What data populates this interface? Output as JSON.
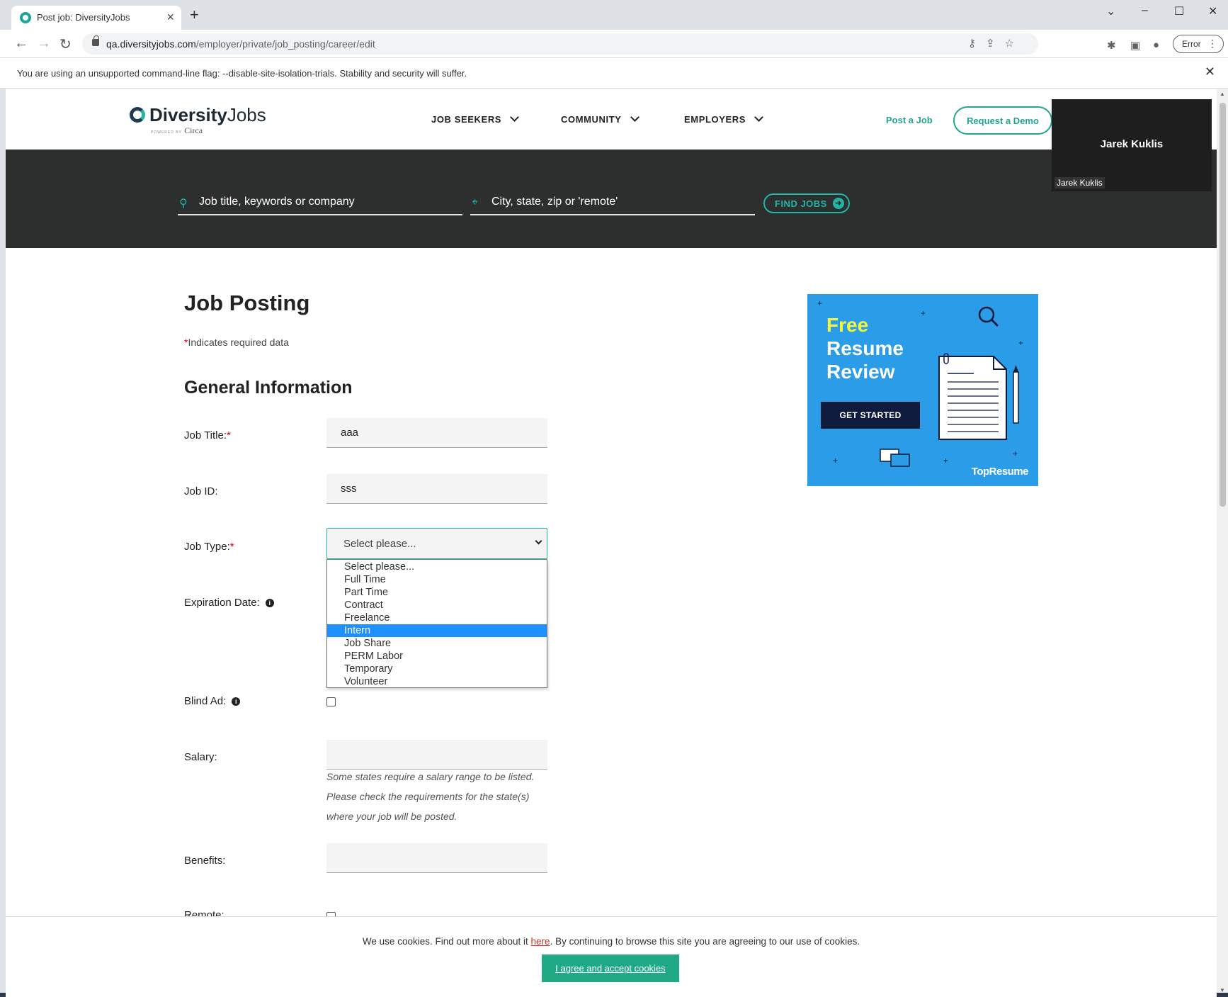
{
  "browser": {
    "tab_title": "Post job: DiversityJobs",
    "url_host": "qa.diversityjobs.com",
    "url_path": "/employer/private/job_posting/career/edit",
    "profile_button": "Error",
    "infobar_text": "You are using an unsupported command-line flag: --disable-site-isolation-trials. Stability and security will suffer."
  },
  "site": {
    "logo_bold": "Diversity",
    "logo_light": "Jobs",
    "logo_powered": "POWERED BY",
    "logo_brand": "Circa",
    "nav": [
      "JOB SEEKERS",
      "COMMUNITY",
      "EMPLOYERS"
    ],
    "post_job": "Post a Job",
    "request_demo": "Request a Demo"
  },
  "video": {
    "name": "Jarek Kuklis",
    "label": "Jarek Kuklis"
  },
  "search": {
    "keyword_placeholder": "Job title, keywords or company",
    "location_placeholder": "City, state, zip or 'remote'",
    "find_button": "FIND JOBS"
  },
  "form": {
    "title": "Job Posting",
    "required_note": "Indicates required data",
    "section": "General Information",
    "job_title_label": "Job Title:",
    "job_title_value": "aaa",
    "job_id_label": "Job ID:",
    "job_id_value": "sss",
    "job_type_label": "Job Type:",
    "job_type_value": "Select please...",
    "job_type_options": [
      "Select please...",
      "Full Time",
      "Part Time",
      "Contract",
      "Freelance",
      "Intern",
      "Job Share",
      "PERM Labor",
      "Temporary",
      "Volunteer"
    ],
    "job_type_highlighted": "Intern",
    "expiration_label": "Expiration Date:",
    "blind_ad_label": "Blind Ad:",
    "salary_label": "Salary:",
    "salary_value": "",
    "salary_help": "Some states require a salary range to be listed. Please check the requirements for the state(s) where your job will be posted.",
    "benefits_label": "Benefits:",
    "benefits_value": "",
    "remote_label": "Remote:"
  },
  "ad": {
    "line1": "Free",
    "line2": "Resume",
    "line3": "Review",
    "button": "GET STARTED",
    "brand": "TopResume"
  },
  "cookie": {
    "text_before": "We use cookies. Find out more about it ",
    "link": "here",
    "text_after": ". By continuing to browse this site you are agreeing to our use of cookies.",
    "button": "I agree and accept cookies"
  },
  "colors": {
    "accent": "#21a594",
    "dark_band": "#2d2e2e",
    "ad_blue": "#2b9ce8",
    "required": "#d0021b",
    "highlight": "#1e90ff"
  }
}
